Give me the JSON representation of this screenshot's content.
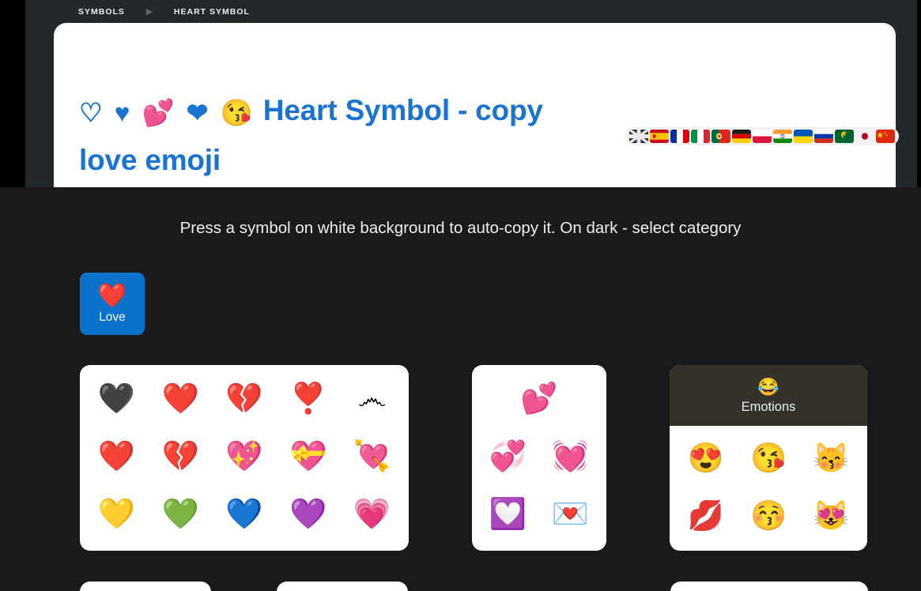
{
  "theme": {
    "page_bg": "#1a1a1a",
    "shell_bg": "#23282b",
    "card_bg": "#ffffff",
    "accent_blue": "#0b72cc",
    "title_blue": "#1a73d1",
    "panel_head_bg": "#35322c",
    "text_light": "#eceff1"
  },
  "breadcrumb": {
    "items": [
      {
        "label": "SYMBOLS"
      },
      {
        "label": "HEART SYMBOL"
      }
    ],
    "separator": "▶"
  },
  "hero": {
    "title_emojis": "♡ ♥ 💕 ❤ 😘",
    "title_text": "Heart Symbol - copy love emoji"
  },
  "languages": [
    {
      "name": "english",
      "flag": "gb"
    },
    {
      "name": "spanish",
      "flag": "es"
    },
    {
      "name": "french",
      "flag": "fr"
    },
    {
      "name": "italian",
      "flag": "it"
    },
    {
      "name": "portuguese",
      "flag": "pt"
    },
    {
      "name": "german",
      "flag": "de"
    },
    {
      "name": "polish",
      "flag": "pl"
    },
    {
      "name": "hindi",
      "flag": "in"
    },
    {
      "name": "ukrainian",
      "flag": "ua"
    },
    {
      "name": "russian",
      "flag": "ru"
    },
    {
      "name": "arabic",
      "flag": "mr"
    },
    {
      "name": "japanese",
      "flag": "jp"
    },
    {
      "name": "chinese",
      "flag": "cn"
    }
  ],
  "subtitle": "Press a symbol on white background to auto-copy it. On dark - select category",
  "categories": [
    {
      "id": "love",
      "icon": "❤️",
      "label": "Love"
    }
  ],
  "panels": {
    "hearts": {
      "name": "hearts-panel",
      "symbols": [
        {
          "char": "🖤",
          "name": "black-heart"
        },
        {
          "char": "❤️",
          "name": "red-heart"
        },
        {
          "char": "💔",
          "name": "heart-pointed"
        },
        {
          "char": "❣️",
          "name": "heart-exclamation"
        },
        {
          "char": "෴",
          "name": "heart-outline-gray"
        },
        {
          "char": "❤️",
          "name": "red-heart-2"
        },
        {
          "char": "💔",
          "name": "broken-heart"
        },
        {
          "char": "💖",
          "name": "sparkling-heart"
        },
        {
          "char": "💝",
          "name": "heart-with-ribbon"
        },
        {
          "char": "💘",
          "name": "heart-with-arrow"
        },
        {
          "char": "💛",
          "name": "yellow-heart"
        },
        {
          "char": "💚",
          "name": "green-heart"
        },
        {
          "char": "💙",
          "name": "blue-heart"
        },
        {
          "char": "💜",
          "name": "purple-heart"
        },
        {
          "char": "💗",
          "name": "growing-heart"
        }
      ]
    },
    "hearts2": {
      "name": "hearts-extra-panel",
      "symbols": [
        {
          "char": "💕",
          "name": "two-hearts",
          "wide": true
        },
        {
          "char": "💞",
          "name": "revolving-hearts"
        },
        {
          "char": "💓",
          "name": "beating-heart"
        },
        {
          "char": "💟",
          "name": "heart-decoration"
        },
        {
          "char": "💌",
          "name": "love-letter"
        }
      ]
    },
    "emotions": {
      "name": "emotions-panel",
      "header_icon": "😂",
      "header_label": "Emotions",
      "symbols": [
        {
          "char": "😍",
          "name": "smiling-face-with-heart-eyes"
        },
        {
          "char": "😘",
          "name": "face-blowing-a-kiss"
        },
        {
          "char": "😽",
          "name": "kissing-cat"
        },
        {
          "char": "💋",
          "name": "kiss-mark"
        },
        {
          "char": "😚",
          "name": "kissing-face-closed-eyes"
        },
        {
          "char": "😻",
          "name": "smiling-cat-with-heart-eyes"
        }
      ]
    }
  }
}
